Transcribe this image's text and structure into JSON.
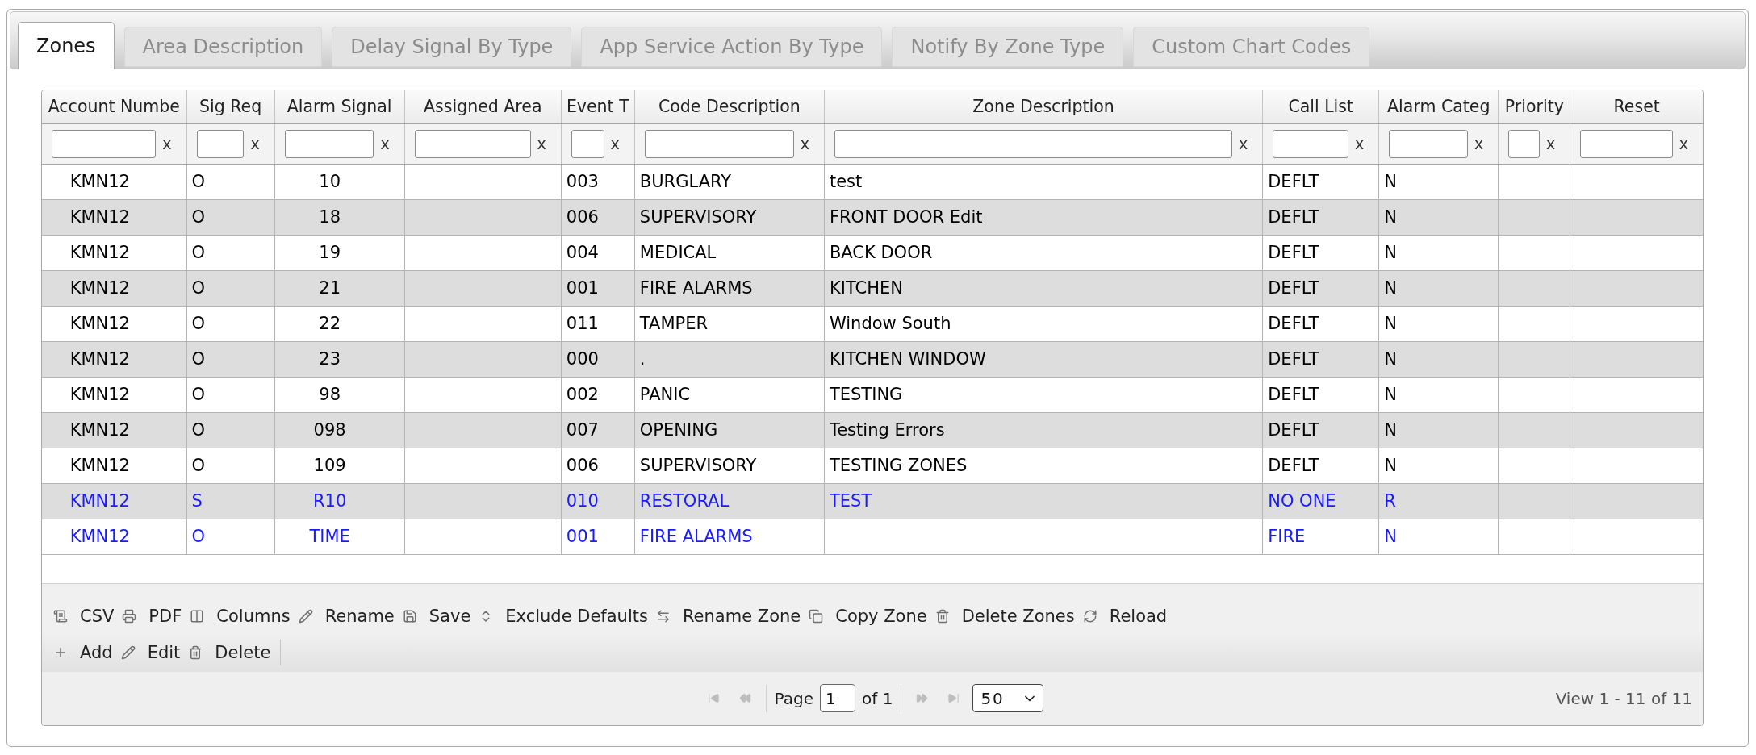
{
  "tabs": [
    {
      "label": "Zones",
      "selected": true
    },
    {
      "label": "Area Description",
      "selected": false
    },
    {
      "label": "Delay Signal By Type",
      "selected": false
    },
    {
      "label": "App Service Action By Type",
      "selected": false
    },
    {
      "label": "Notify By Zone Type",
      "selected": false
    },
    {
      "label": "Custom Chart Codes",
      "selected": false
    }
  ],
  "table": {
    "columns": [
      {
        "label": "Account Numbe",
        "filter_clear": "x"
      },
      {
        "label": "Sig Req",
        "filter_clear": "x"
      },
      {
        "label": "Alarm Signal",
        "filter_clear": "x"
      },
      {
        "label": "Assigned Area",
        "filter_clear": "x"
      },
      {
        "label": "Event T",
        "filter_clear": "x"
      },
      {
        "label": "Code Description",
        "filter_clear": "x"
      },
      {
        "label": "Zone Description",
        "filter_clear": "x"
      },
      {
        "label": "Call List",
        "filter_clear": "x"
      },
      {
        "label": "Alarm Categ",
        "filter_clear": "x"
      },
      {
        "label": "Priority",
        "filter_clear": "x"
      },
      {
        "label": "Reset",
        "filter_clear": "x"
      }
    ],
    "rows": [
      {
        "account": "KMN12",
        "sig_req": "O",
        "alarm_signal": "10",
        "event_t": "003",
        "code_description": "BURGLARY",
        "zone_description": "test",
        "call_list": "DEFLT",
        "alarm_categ": "N",
        "color": "#000000"
      },
      {
        "account": "KMN12",
        "sig_req": "O",
        "alarm_signal": "18",
        "event_t": "006",
        "code_description": "SUPERVISORY",
        "zone_description": "FRONT DOOR Edit",
        "call_list": "DEFLT",
        "alarm_categ": "N",
        "color": "#000000"
      },
      {
        "account": "KMN12",
        "sig_req": "O",
        "alarm_signal": "19",
        "event_t": "004",
        "code_description": "MEDICAL",
        "zone_description": "BACK DOOR",
        "call_list": "DEFLT",
        "alarm_categ": "N",
        "color": "#000000"
      },
      {
        "account": "KMN12",
        "sig_req": "O",
        "alarm_signal": "21",
        "event_t": "001",
        "code_description": "FIRE ALARMS",
        "zone_description": "KITCHEN",
        "call_list": "DEFLT",
        "alarm_categ": "N",
        "color": "#000000"
      },
      {
        "account": "KMN12",
        "sig_req": "O",
        "alarm_signal": "22",
        "event_t": "011",
        "code_description": "TAMPER",
        "zone_description": "Window South",
        "call_list": "DEFLT",
        "alarm_categ": "N",
        "color": "#000000"
      },
      {
        "account": "KMN12",
        "sig_req": "O",
        "alarm_signal": "23",
        "event_t": "000",
        "code_description": ".",
        "zone_description": "KITCHEN WINDOW",
        "call_list": "DEFLT",
        "alarm_categ": "N",
        "color": "#000000"
      },
      {
        "account": "KMN12",
        "sig_req": "O",
        "alarm_signal": "98",
        "event_t": "002",
        "code_description": "PANIC",
        "zone_description": "TESTING",
        "call_list": "DEFLT",
        "alarm_categ": "N",
        "color": "#000000"
      },
      {
        "account": "KMN12",
        "sig_req": "O",
        "alarm_signal": "098",
        "event_t": "007",
        "code_description": "OPENING",
        "zone_description": "Testing Errors",
        "call_list": "DEFLT",
        "alarm_categ": "N",
        "color": "#000000"
      },
      {
        "account": "KMN12",
        "sig_req": "O",
        "alarm_signal": "109",
        "event_t": "006",
        "code_description": "SUPERVISORY",
        "zone_description": "TESTING ZONES",
        "call_list": "DEFLT",
        "alarm_categ": "N",
        "color": "#000000"
      },
      {
        "account": "KMN12",
        "sig_req": "S",
        "alarm_signal": "R10",
        "event_t": "010",
        "code_description": "RESTORAL",
        "zone_description": "TEST",
        "call_list": "NO ONE",
        "alarm_categ": "R",
        "color": "#1a1aff"
      },
      {
        "account": "KMN12",
        "sig_req": "O",
        "alarm_signal": "TIME",
        "event_t": "001",
        "code_description": "FIRE ALARMS",
        "call_list": "FIRE",
        "alarm_categ": "N",
        "color": "#1a1aff"
      }
    ]
  },
  "toolbar": {
    "rows": [
      [
        {
          "kind": "csv",
          "label": "CSV"
        },
        {
          "kind": "pdf",
          "label": "PDF"
        },
        {
          "kind": "columns",
          "label": "Columns"
        },
        {
          "kind": "rename",
          "label": "Rename"
        },
        {
          "kind": "save",
          "label": "Save"
        },
        {
          "kind": "exclude",
          "label": "Exclude Defaults"
        },
        {
          "kind": "rename_zone",
          "label": "Rename Zone"
        },
        {
          "kind": "copy",
          "label": "Copy Zone"
        },
        {
          "kind": "delete",
          "label": "Delete Zones"
        },
        {
          "kind": "reload",
          "label": "Reload"
        }
      ],
      [
        {
          "kind": "add",
          "label": "Add"
        },
        {
          "kind": "edit",
          "label": "Edit"
        },
        {
          "kind": "delete",
          "label": "Delete"
        }
      ]
    ]
  },
  "pager": {
    "back_buttons": [
      {
        "kind": "first",
        "disabled": true
      },
      {
        "kind": "previous",
        "disabled": true
      }
    ],
    "page_label": "Page",
    "page_value": "1",
    "page_total": "of 1",
    "forward_buttons": [
      {
        "kind": "next",
        "disabled": true
      },
      {
        "kind": "last",
        "disabled": true
      }
    ],
    "page_size": "50",
    "record_info": "View 1 - 11 of 11"
  }
}
